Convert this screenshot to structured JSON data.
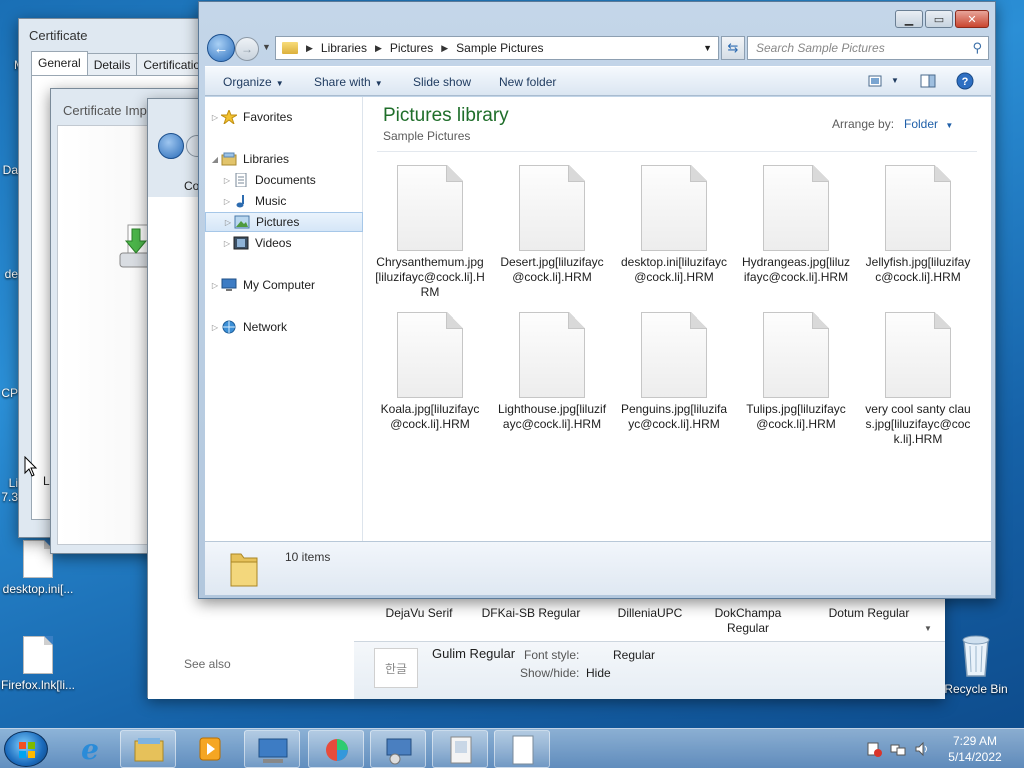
{
  "desktop": {
    "icons": [
      {
        "label": "My"
      },
      {
        "label": "Da"
      },
      {
        "label": "de"
      },
      {
        "label": "CP"
      },
      {
        "label": "Li"
      },
      {
        "label": "7.3"
      },
      {
        "label": "desktop.ini[..."
      },
      {
        "label": "Firefox.lnk[li..."
      },
      {
        "label": "Recycle Bin"
      }
    ]
  },
  "certificate_window": {
    "title": "Certificate",
    "tabs": [
      "General",
      "Details",
      "Certification P"
    ],
    "left_text": "Le"
  },
  "wizard_window": {
    "title": "Certificate Impo"
  },
  "fonts_window": {
    "co_text": "Co",
    "see_also": "See also",
    "fonts": [
      "DejaVu Serif",
      "DFKai-SB Regular",
      "DilleniaUPC",
      "DokChampa Regular",
      "Dotum Regular"
    ],
    "details": {
      "preview": "한글",
      "name": "Gulim Regular",
      "font_style_label": "Font style:",
      "font_style_value": "Regular",
      "show_hide_label": "Show/hide:",
      "show_hide_value": "Hide"
    }
  },
  "explorer": {
    "breadcrumb": [
      "Libraries",
      "Pictures",
      "Sample Pictures"
    ],
    "search_placeholder": "Search Sample Pictures",
    "toolbar": {
      "organize": "Organize",
      "share_with": "Share with",
      "slide_show": "Slide show",
      "new_folder": "New folder"
    },
    "nav": {
      "favorites": "Favorites",
      "libraries": "Libraries",
      "documents": "Documents",
      "music": "Music",
      "pictures": "Pictures",
      "videos": "Videos",
      "my_computer": "My Computer",
      "network": "Network"
    },
    "library_title": "Pictures library",
    "library_subtitle": "Sample Pictures",
    "arrange_by_label": "Arrange by:",
    "arrange_by_value": "Folder",
    "files": [
      "Chrysanthemum.jpg[liluzifayc@cock.li].HRM",
      "Desert.jpg[liluzifayc@cock.li].HRM",
      "desktop.ini[liluzifayc@cock.li].HRM",
      "Hydrangeas.jpg[liluzifayc@cock.li].HRM",
      "Jellyfish.jpg[liluzifayc@cock.li].HRM",
      "Koala.jpg[liluzifayc@cock.li].HRM",
      "Lighthouse.jpg[liluzifayc@cock.li].HRM",
      "Penguins.jpg[liluzifayc@cock.li].HRM",
      "Tulips.jpg[liluzifayc@cock.li].HRM",
      "very cool santy claus.jpg[liluzifayc@cock.li].HRM"
    ],
    "status": "10 items"
  },
  "taskbar": {
    "time": "7:29 AM",
    "date": "5/14/2022"
  },
  "colors": {
    "library_title": "#1f6e2a",
    "link_blue": "#1f5fa8",
    "selection": "#d5e6f7"
  }
}
